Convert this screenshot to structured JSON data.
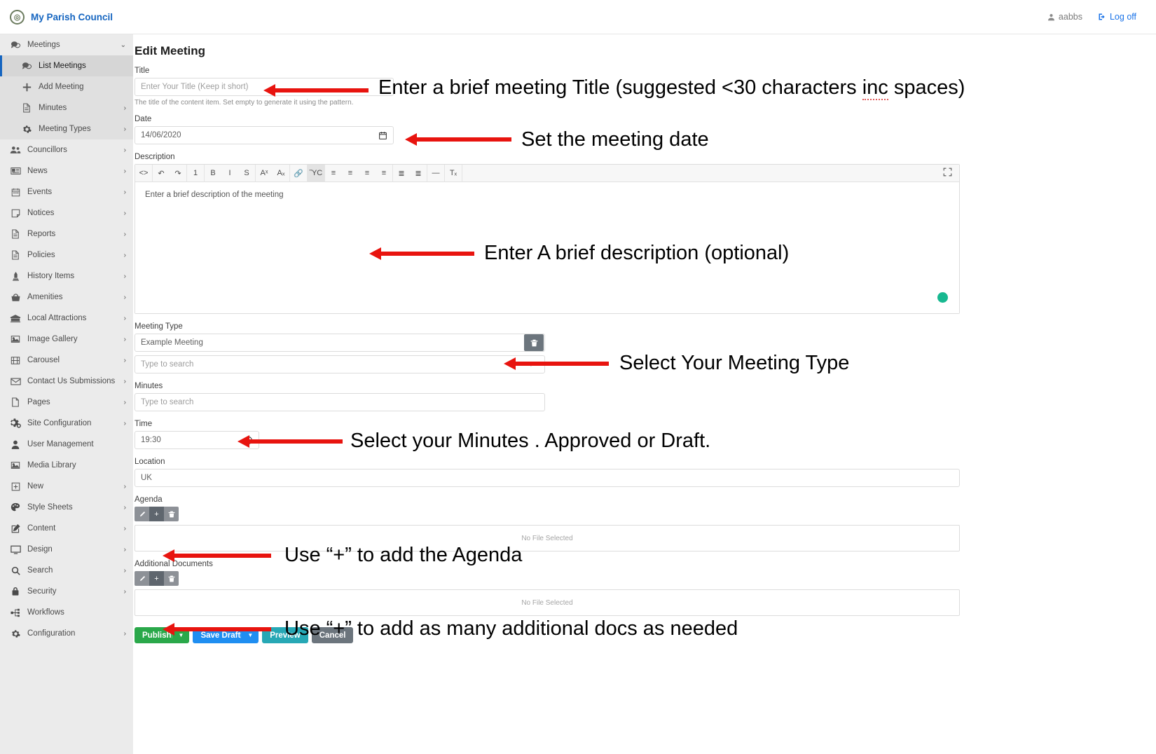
{
  "topbar": {
    "brand": "My Parish Council",
    "user": "aabbs",
    "logoff": "Log off"
  },
  "sidebar": {
    "items": [
      {
        "label": "Meetings",
        "icon": "chat-icon",
        "chevron": "⌄",
        "level": 0
      },
      {
        "label": "List Meetings",
        "icon": "chat-icon",
        "chevron": "",
        "level": 1,
        "active": true
      },
      {
        "label": "Add Meeting",
        "icon": "plus-icon",
        "chevron": "",
        "level": 1
      },
      {
        "label": "Minutes",
        "icon": "document-icon",
        "chevron": "›",
        "level": 1
      },
      {
        "label": "Meeting Types",
        "icon": "gear-icon",
        "chevron": "›",
        "level": 1
      },
      {
        "label": "Councillors",
        "icon": "users-icon",
        "chevron": "›",
        "level": 0
      },
      {
        "label": "News",
        "icon": "newspaper-icon",
        "chevron": "›",
        "level": 0
      },
      {
        "label": "Events",
        "icon": "calendar-icon",
        "chevron": "›",
        "level": 0
      },
      {
        "label": "Notices",
        "icon": "note-icon",
        "chevron": "›",
        "level": 0
      },
      {
        "label": "Reports",
        "icon": "document-icon",
        "chevron": "›",
        "level": 0
      },
      {
        "label": "Policies",
        "icon": "document-icon",
        "chevron": "›",
        "level": 0
      },
      {
        "label": "History Items",
        "icon": "monument-icon",
        "chevron": "›",
        "level": 0
      },
      {
        "label": "Amenities",
        "icon": "basket-icon",
        "chevron": "›",
        "level": 0
      },
      {
        "label": "Local Attractions",
        "icon": "landmark-icon",
        "chevron": "›",
        "level": 0
      },
      {
        "label": "Image Gallery",
        "icon": "image-icon",
        "chevron": "›",
        "level": 0
      },
      {
        "label": "Carousel",
        "icon": "film-icon",
        "chevron": "›",
        "level": 0
      },
      {
        "label": "Contact Us Submissions",
        "icon": "envelope-icon",
        "chevron": "›",
        "level": 0
      },
      {
        "label": "Pages",
        "icon": "page-icon",
        "chevron": "›",
        "level": 0
      },
      {
        "label": "Site Configuration",
        "icon": "gears-icon",
        "chevron": "›",
        "level": 0
      },
      {
        "label": "User Management",
        "icon": "user-icon",
        "chevron": "",
        "level": 0
      },
      {
        "label": "Media Library",
        "icon": "image-icon",
        "chevron": "",
        "level": 0
      },
      {
        "label": "New",
        "icon": "plus-square-icon",
        "chevron": "›",
        "level": 0
      },
      {
        "label": "Style Sheets",
        "icon": "palette-icon",
        "chevron": "›",
        "level": 0
      },
      {
        "label": "Content",
        "icon": "pencil-square-icon",
        "chevron": "›",
        "level": 0
      },
      {
        "label": "Design",
        "icon": "monitor-icon",
        "chevron": "›",
        "level": 0
      },
      {
        "label": "Search",
        "icon": "search-icon",
        "chevron": "›",
        "level": 0
      },
      {
        "label": "Security",
        "icon": "lock-icon",
        "chevron": "›",
        "level": 0
      },
      {
        "label": "Workflows",
        "icon": "workflow-icon",
        "chevron": "",
        "level": 0
      },
      {
        "label": "Configuration",
        "icon": "gear-icon",
        "chevron": "›",
        "level": 0
      }
    ]
  },
  "page": {
    "title": "Edit Meeting",
    "fields": {
      "title_label": "Title",
      "title_placeholder": "Enter Your Title (Keep it short)",
      "title_help": "The title of the content item. Set empty to generate it using the pattern.",
      "date_label": "Date",
      "date_value": "14/06/2020",
      "description_label": "Description",
      "description_text": "Enter a brief description of the meeting",
      "meeting_type_label": "Meeting Type",
      "meeting_type_value": "Example Meeting",
      "meeting_type_search_placeholder": "Type to search",
      "minutes_label": "Minutes",
      "minutes_search_placeholder": "Type to search",
      "time_label": "Time",
      "time_value": "19:30",
      "location_label": "Location",
      "location_value": "UK",
      "agenda_label": "Agenda",
      "agenda_file": "No File Selected",
      "additional_docs_label": "Additional Documents",
      "additional_docs_file": "No File Selected"
    },
    "editor_toolbar": [
      {
        "name": "source-code-icon",
        "glyph": "<>"
      },
      {
        "name": "undo-icon",
        "glyph": "↶"
      },
      {
        "name": "redo-icon",
        "glyph": "↷"
      },
      {
        "name": "heading-icon",
        "glyph": "1"
      },
      {
        "name": "bold-icon",
        "glyph": "B"
      },
      {
        "name": "italic-icon",
        "glyph": "I"
      },
      {
        "name": "strikethrough-icon",
        "glyph": "S"
      },
      {
        "name": "superscript-icon",
        "glyph": "Aˣ"
      },
      {
        "name": "subscript-icon",
        "glyph": "Aₓ"
      },
      {
        "name": "link-icon",
        "glyph": "🔗"
      },
      {
        "name": "image-icon",
        "glyph": "ὛC"
      },
      {
        "name": "align-left-icon",
        "glyph": "≡"
      },
      {
        "name": "align-center-icon",
        "glyph": "≡"
      },
      {
        "name": "align-right-icon",
        "glyph": "≡"
      },
      {
        "name": "align-justify-icon",
        "glyph": "≡"
      },
      {
        "name": "ordered-list-icon",
        "glyph": "≣"
      },
      {
        "name": "unordered-list-icon",
        "glyph": "≣"
      },
      {
        "name": "horizontal-rule-icon",
        "glyph": "—"
      },
      {
        "name": "clear-format-icon",
        "glyph": "Tₓ"
      }
    ],
    "buttons": {
      "publish": "Publish",
      "save_draft": "Save Draft",
      "preview": "Preview",
      "cancel": "Cancel"
    }
  },
  "annotations": {
    "title": "Enter a brief meeting Title (suggested <30 characters ",
    "title_spell": "inc",
    "title_tail": " spaces)",
    "date": "Set the meeting date",
    "description": "Enter A brief description (optional)",
    "meeting_type": "Select Your Meeting Type",
    "minutes": "Select your Minutes . Approved or Draft.",
    "agenda": "Use “+” to add the Agenda",
    "additional": "Use “+” to add as many additional docs as needed"
  },
  "colors": {
    "brand": "#1565c0",
    "arrow": "#e8140f",
    "publish": "#2aa84a",
    "draft": "#1f8ef1",
    "preview": "#27a8b5",
    "cancel": "#6c757d"
  }
}
